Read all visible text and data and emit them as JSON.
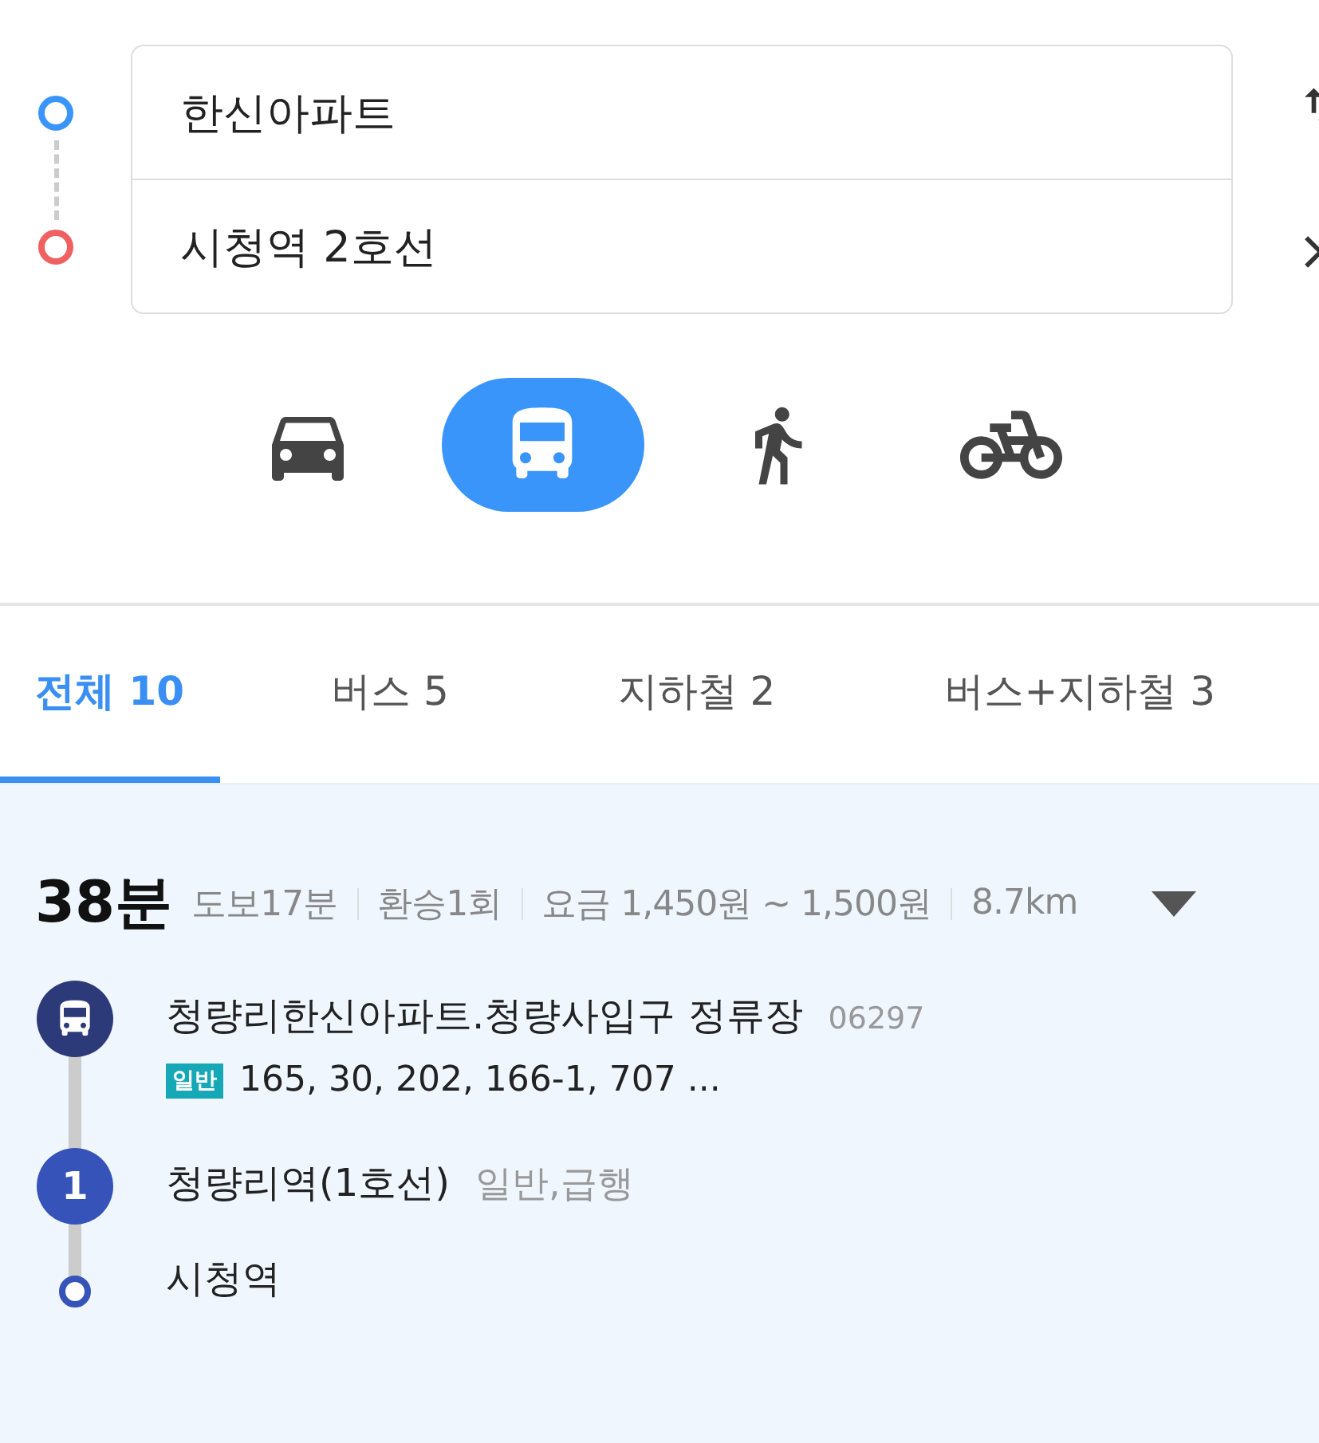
{
  "route_inputs": [
    {
      "kind": "origin",
      "value": "한신아파트"
    },
    {
      "kind": "destination",
      "value": "시청역 2호선"
    }
  ],
  "modes": [
    {
      "kind": "car",
      "selected": false
    },
    {
      "kind": "bus",
      "selected": true
    },
    {
      "kind": "walk",
      "selected": false
    },
    {
      "kind": "bike",
      "selected": false
    }
  ],
  "tabs": [
    {
      "label": "전체 10",
      "selected": true
    },
    {
      "label": "버스 5",
      "selected": false
    },
    {
      "label": "지하철 2",
      "selected": false
    },
    {
      "label": "버스+지하철 3",
      "selected": false
    }
  ],
  "route": {
    "duration": "38분",
    "details": [
      "도보17분",
      "환승1회",
      "요금 1,450원 ~ 1,500원",
      "8.7km"
    ],
    "steps": [
      {
        "kind": "bus",
        "name": "청량리한신아파트.청량사입구 정류장",
        "code": "06297",
        "badge": "일반",
        "buses": "165, 30, 202, 166-1, 707 ..."
      },
      {
        "kind": "subway",
        "number": "1",
        "name": "청량리역(1호선)",
        "note": "일반,급행"
      },
      {
        "kind": "end",
        "name": "시청역"
      }
    ]
  }
}
